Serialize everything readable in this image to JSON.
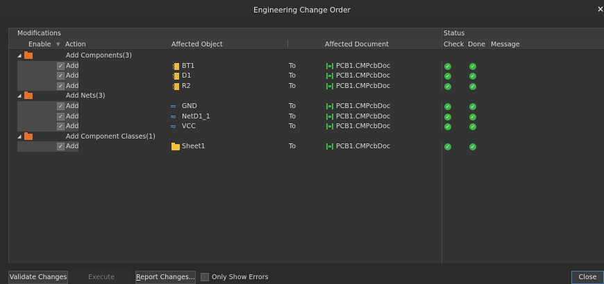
{
  "window": {
    "title": "Engineering Change Order",
    "close_glyph": "×"
  },
  "headers": {
    "modifications": "Modifications",
    "status": "Status",
    "enable": "Enable",
    "action": "Action",
    "affected_object": "Affected Object",
    "affected_document": "Affected Document",
    "check": "Check",
    "done": "Done",
    "message": "Message"
  },
  "groups": [
    {
      "label": "Add Components(3)",
      "icon": "folder-icon",
      "rows": [
        {
          "action": "Add",
          "object": "BT1",
          "object_icon": "component-icon",
          "to": "To",
          "document": "PCB1.CMPcbDoc",
          "check": true,
          "done": true
        },
        {
          "action": "Add",
          "object": "D1",
          "object_icon": "component-icon",
          "to": "To",
          "document": "PCB1.CMPcbDoc",
          "check": true,
          "done": true
        },
        {
          "action": "Add",
          "object": "R2",
          "object_icon": "component-icon",
          "to": "To",
          "document": "PCB1.CMPcbDoc",
          "check": true,
          "done": true
        }
      ]
    },
    {
      "label": "Add Nets(3)",
      "icon": "folder-icon",
      "rows": [
        {
          "action": "Add",
          "object": "GND",
          "object_icon": "net-icon",
          "to": "To",
          "document": "PCB1.CMPcbDoc",
          "check": true,
          "done": true
        },
        {
          "action": "Add",
          "object": "NetD1_1",
          "object_icon": "net-icon",
          "to": "To",
          "document": "PCB1.CMPcbDoc",
          "check": true,
          "done": true
        },
        {
          "action": "Add",
          "object": "VCC",
          "object_icon": "net-icon",
          "to": "To",
          "document": "PCB1.CMPcbDoc",
          "check": true,
          "done": true
        }
      ]
    },
    {
      "label": "Add Component Classes(1)",
      "icon": "folder-icon",
      "rows": [
        {
          "action": "Add",
          "object": "Sheet1",
          "object_icon": "class-folder-icon",
          "to": "To",
          "document": "PCB1.CMPcbDoc",
          "check": true,
          "done": true
        }
      ]
    }
  ],
  "buttons": {
    "validate": "Validate Changes",
    "execute": "Execute Changes",
    "report_prefix": "R",
    "report_rest": "eport Changes...",
    "only_errors": "Only Show Errors",
    "close": "Close"
  },
  "colors": {
    "ok_green": "#3db34a",
    "net_blue": "#5a9ee6",
    "folder_orange": "#e8722a",
    "comp_yellow": "#e8b840"
  }
}
